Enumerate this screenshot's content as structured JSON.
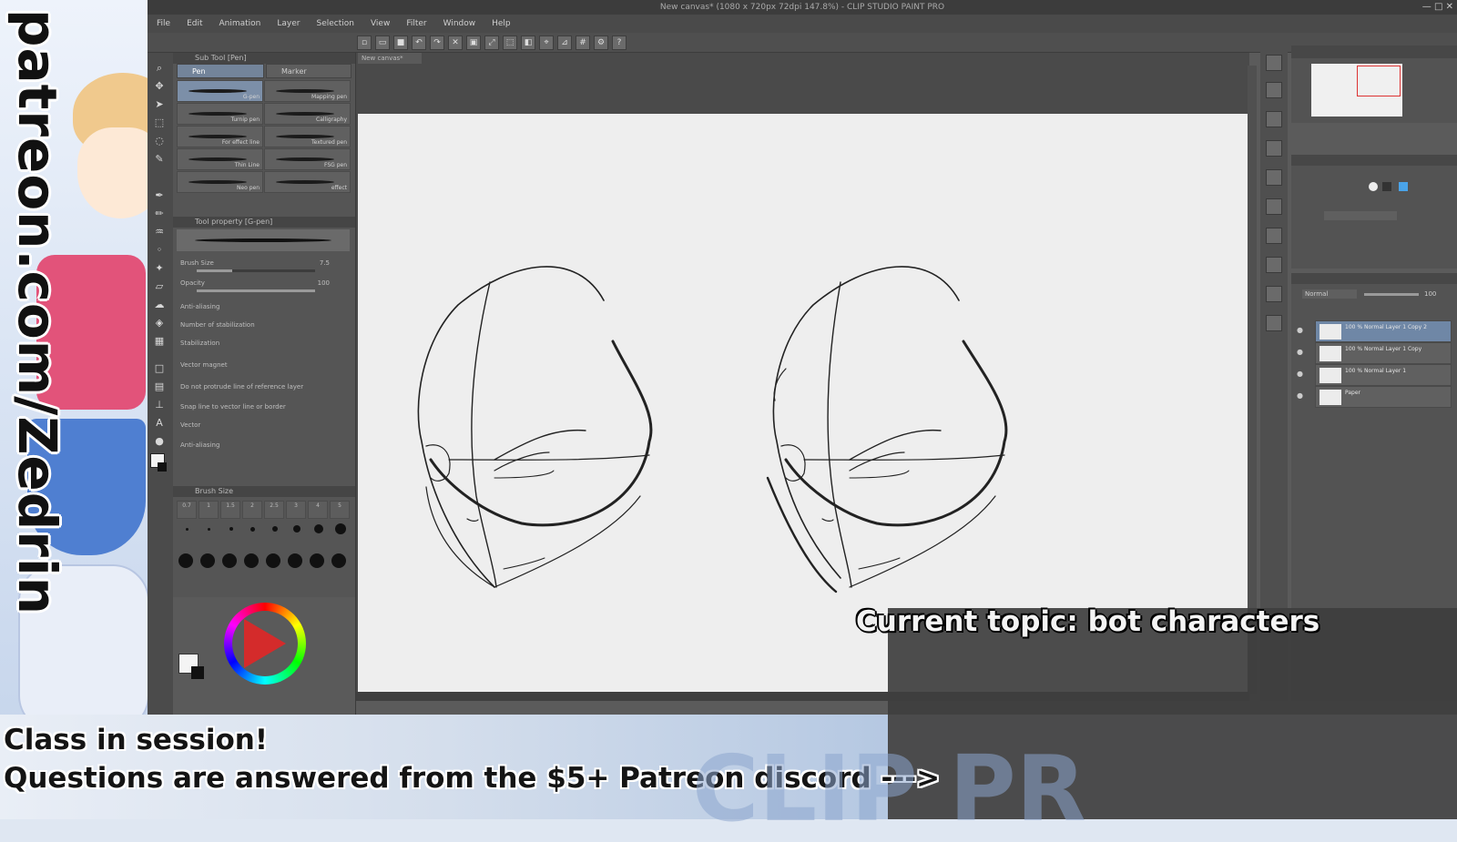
{
  "window": {
    "title": "New canvas* (1080 x 720px 72dpi 147.8%) - CLIP STUDIO PAINT PRO",
    "controls": [
      "—",
      "□",
      "✕"
    ]
  },
  "menu": [
    "File",
    "Edit",
    "Animation",
    "Layer",
    "Selection",
    "View",
    "Filter",
    "Window",
    "Help"
  ],
  "subtool": {
    "panel_title": "Sub Tool [Pen]",
    "tabs": [
      "Pen",
      "Marker"
    ],
    "brushes": [
      {
        "label": "G-pen"
      },
      {
        "label": "Mapping pen"
      },
      {
        "label": "Turnip pen"
      },
      {
        "label": "Calligraphy"
      },
      {
        "label": "For effect line"
      },
      {
        "label": "Textured pen"
      },
      {
        "label": "Thin Line"
      },
      {
        "label": "FSG pen"
      },
      {
        "label": "Neo pen"
      },
      {
        "label": "effect"
      }
    ],
    "detail_title": "Tool property [G-pen]",
    "properties": [
      {
        "label": "Brush Size",
        "value": "7.5"
      },
      {
        "label": "Opacity",
        "value": "100"
      },
      {
        "label": "Anti-aliasing",
        "value": ""
      },
      {
        "label": "Number of stabilization",
        "value": ""
      },
      {
        "label": "Stabilization",
        "value": ""
      },
      {
        "label": "Vector magnet",
        "value": ""
      },
      {
        "label": "Do not protrude line of reference layer",
        "value": ""
      },
      {
        "label": "Snap line to vector line or border",
        "value": ""
      },
      {
        "label": "Vector",
        "value": ""
      },
      {
        "label": "Anti-aliasing",
        "value": ""
      }
    ],
    "size_title": "Brush Size",
    "sizes": [
      "0.7",
      "1",
      "1.5",
      "2",
      "2.5",
      "3",
      "4",
      "5"
    ]
  },
  "canvas": {
    "tab": "New canvas*"
  },
  "layers": {
    "blend_mode": "Normal",
    "opacity": "100",
    "items": [
      {
        "name": "100 % Normal Layer 1 Copy 2",
        "selected": true
      },
      {
        "name": "100 % Normal Layer 1 Copy",
        "selected": false
      },
      {
        "name": "100 % Normal Layer 1",
        "selected": false
      },
      {
        "name": "Paper",
        "selected": false
      }
    ]
  },
  "overlay": {
    "vertical_url": "patreon.com/Zedrin",
    "topic": "Current topic: bot characters",
    "banner_line1": "Class in session!",
    "banner_line2": "Questions are answered from the $5+ Patreon discord --->",
    "watermark": "CLIP PR"
  },
  "colors": {
    "accent": "#73849a",
    "play": "#d42b2b"
  }
}
